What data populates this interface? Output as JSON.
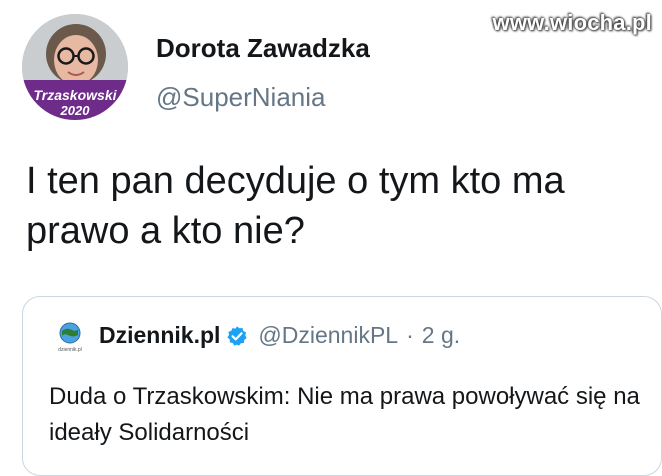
{
  "author": {
    "name": "Dorota Zawadzka",
    "handle": "@SuperNiania",
    "avatar_badge_line1": "Trzaskowski",
    "avatar_badge_line2": "2020"
  },
  "watermark": "www.wiocha.pl",
  "tweet": {
    "text": "I ten pan decyduje o tym kto ma prawo a kto nie?"
  },
  "quoted_tweet": {
    "logo_icon": "dziennik-globe-icon",
    "logo_caption": "dziennik.pl",
    "name": "Dziennik.pl",
    "verified_icon": "verified-badge-icon",
    "handle": "@DziennikPL",
    "separator": "·",
    "time": "2 g.",
    "text": "Duda o Trzaskowskim: Nie ma prawa powoływać się na ideały Solidarności"
  },
  "colors": {
    "text_primary": "#14171a",
    "text_secondary": "#657786",
    "verified_blue": "#1da1f2",
    "card_border": "#ccd6dd"
  }
}
